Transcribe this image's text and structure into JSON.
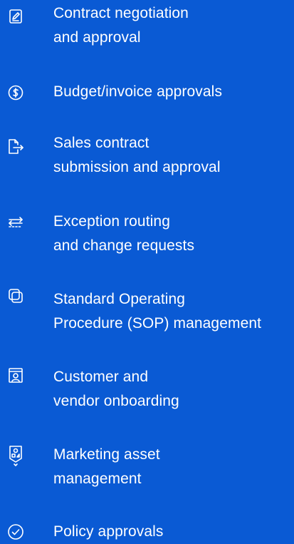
{
  "list": {
    "items": [
      {
        "icon": "pen-square-icon",
        "line1": "Contract negotiation",
        "line2": "and approval"
      },
      {
        "icon": "dollar-circle-icon",
        "line1": "Budget/invoice approvals",
        "line2": ""
      },
      {
        "icon": "document-arrow-icon",
        "line1": "Sales contract",
        "line2": "submission and approval"
      },
      {
        "icon": "routing-arrows-icon",
        "line1": "Exception routing",
        "line2": "and change requests"
      },
      {
        "icon": "stacked-squares-icon",
        "line1": "Standard Operating",
        "line2": "Procedure (SOP) management"
      },
      {
        "icon": "vendor-card-icon",
        "line1": "Customer and",
        "line2": "vendor onboarding"
      },
      {
        "icon": "asset-tag-icon",
        "line1": "Marketing asset",
        "line2": "management"
      },
      {
        "icon": "check-circle-icon",
        "line1": "Policy approvals",
        "line2": ""
      }
    ]
  },
  "colors": {
    "background": "#0a5ad4",
    "text": "#ffffff"
  }
}
